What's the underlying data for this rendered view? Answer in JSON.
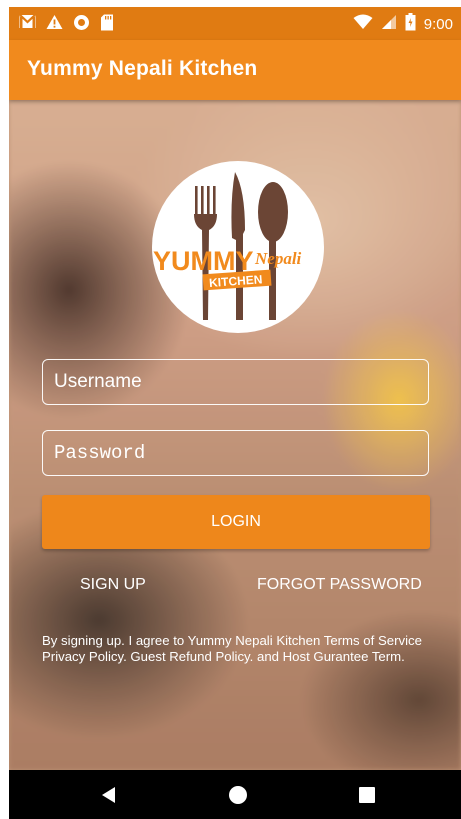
{
  "status_bar": {
    "time": "9:00",
    "icons": [
      "gmail-icon",
      "warning-icon",
      "circle-icon",
      "sd-card-icon",
      "wifi-icon",
      "signal-icon",
      "battery-icon"
    ]
  },
  "app_bar": {
    "title": "Yummy Nepali Kitchen"
  },
  "logo": {
    "text_yummy": "YUMMY",
    "text_nepali": "Nepali",
    "text_kitchen": "KITCHEN"
  },
  "form": {
    "username_placeholder": "Username",
    "password_placeholder": "Password",
    "login_label": "LOGIN",
    "signup_label": "SIGN UP",
    "forgot_label": "FORGOT PASSWORD"
  },
  "terms_text": "By signing up. I agree to Yummy Nepali Kitchen Terms of Service Privacy Policy. Guest Refund Policy. and Host Gurantee Term.",
  "colors": {
    "primary": "#f18a1d",
    "primary_dark": "#e07b12",
    "button": "#ee871b"
  },
  "nav_bar": {
    "icons": [
      "back-icon",
      "home-icon",
      "recents-icon"
    ]
  }
}
